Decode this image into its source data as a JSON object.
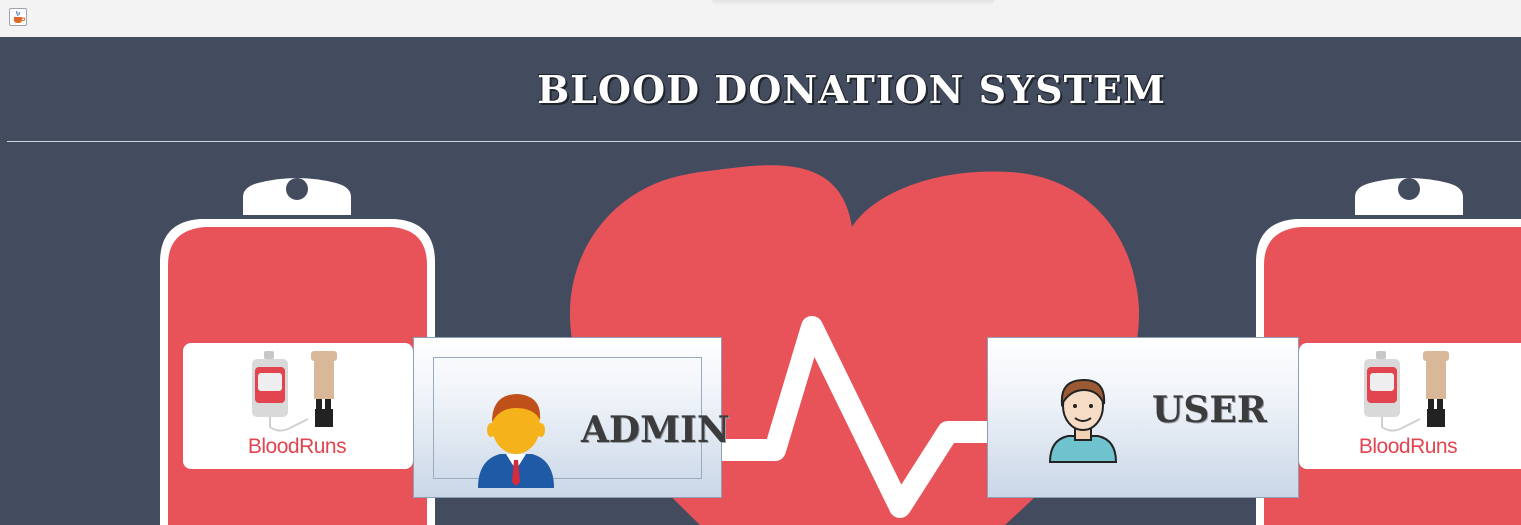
{
  "window": {
    "app_icon": "java-cup-icon"
  },
  "header": {
    "title": "BLOOD DONATION SYSTEM"
  },
  "buttons": {
    "admin": {
      "label": "ADMIN",
      "icon": "admin-person-icon"
    },
    "user": {
      "label": "USER",
      "icon": "user-person-icon"
    }
  },
  "logos": {
    "left": {
      "text": "BloodRuns"
    },
    "right": {
      "text": "BloodRuns"
    }
  },
  "colors": {
    "background": "#434c5e",
    "accent_red": "#e8535a",
    "white": "#ffffff",
    "button_gradient_bottom": "#c9d7e7"
  }
}
